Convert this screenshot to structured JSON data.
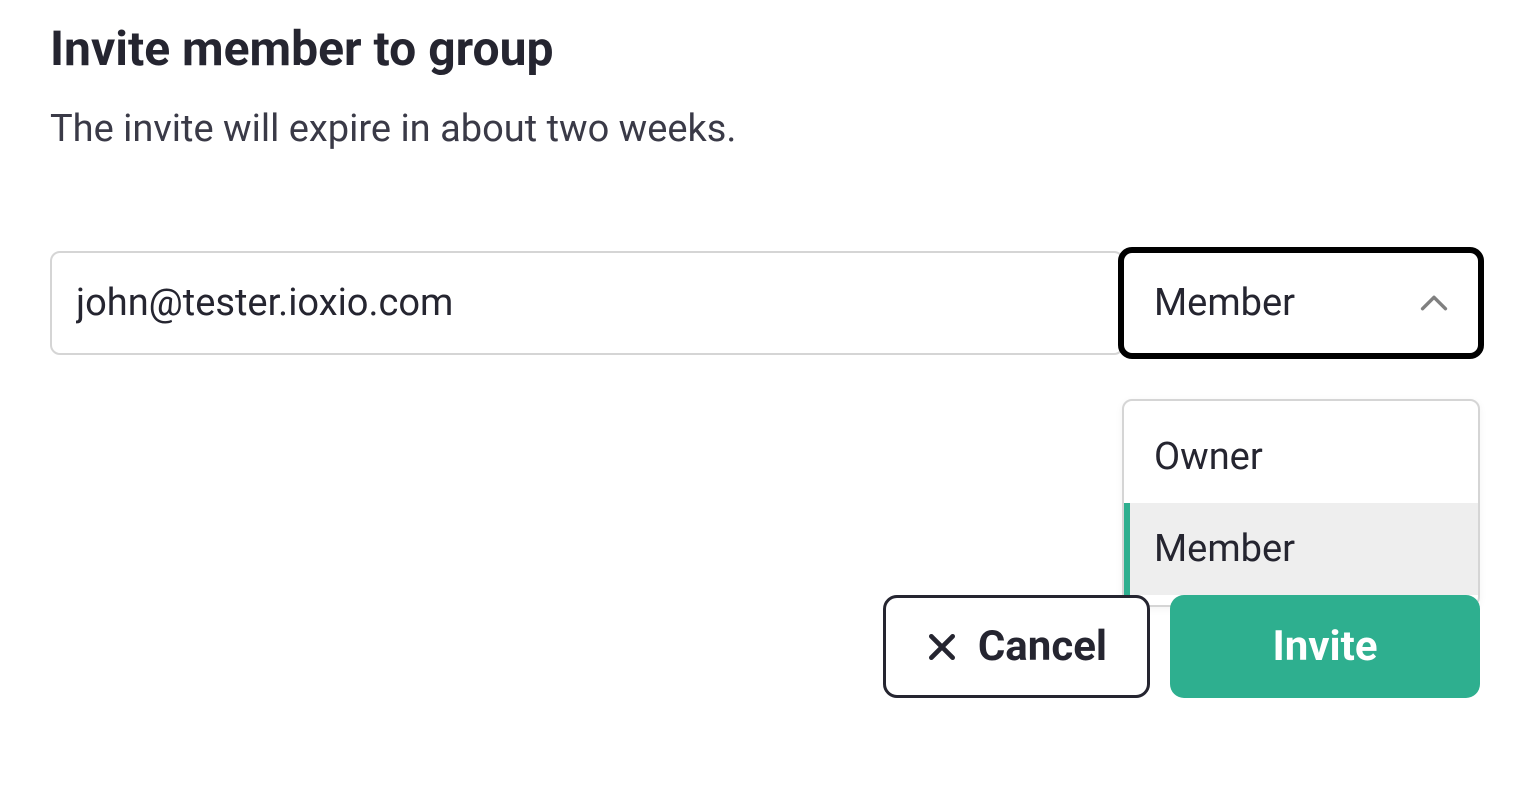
{
  "dialog": {
    "title": "Invite member to group",
    "subtitle": "The invite will expire in about two weeks.",
    "email_value": "john@tester.ioxio.com",
    "role_selected": "Member",
    "dropdown": {
      "options": [
        {
          "label": "Owner"
        },
        {
          "label": "Member"
        }
      ],
      "selected_index": 1
    },
    "actions": {
      "cancel_label": "Cancel",
      "invite_label": "Invite"
    }
  }
}
